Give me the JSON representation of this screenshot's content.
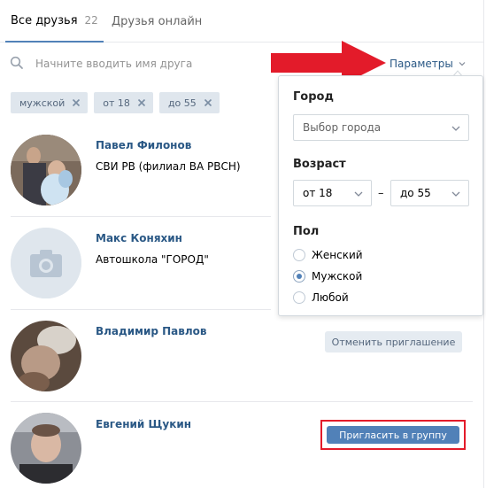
{
  "tabs": {
    "all_friends_label": "Все друзья",
    "all_friends_count": "22",
    "online_label": "Друзья онлайн"
  },
  "search": {
    "placeholder": "Начните вводить имя друга",
    "params_label": "Параметры"
  },
  "filter_tags": [
    "мужской",
    "от 18",
    "до 55"
  ],
  "friends": [
    {
      "name": "Павел Филонов",
      "subtitle": "СВИ РВ (филиал ВА РВСН)"
    },
    {
      "name": "Макс Коняхин",
      "subtitle": "Автошкола \"ГОРОД\""
    },
    {
      "name": "Владимир Павлов",
      "subtitle": "",
      "action": "Отменить приглашение"
    },
    {
      "name": "Евгений Щукин",
      "subtitle": "",
      "action": "Пригласить в группу"
    }
  ],
  "params_panel": {
    "city_label": "Город",
    "city_value": "Выбор города",
    "age_label": "Возраст",
    "age_from": "от 18",
    "age_sep": "–",
    "age_to": "до 55",
    "sex_label": "Пол",
    "sex_options": [
      "Женский",
      "Мужской",
      "Любой"
    ],
    "sex_selected": "Мужской"
  },
  "colors": {
    "accent": "#5181b8",
    "link": "#2a5885",
    "highlight": "#e31b2a"
  }
}
